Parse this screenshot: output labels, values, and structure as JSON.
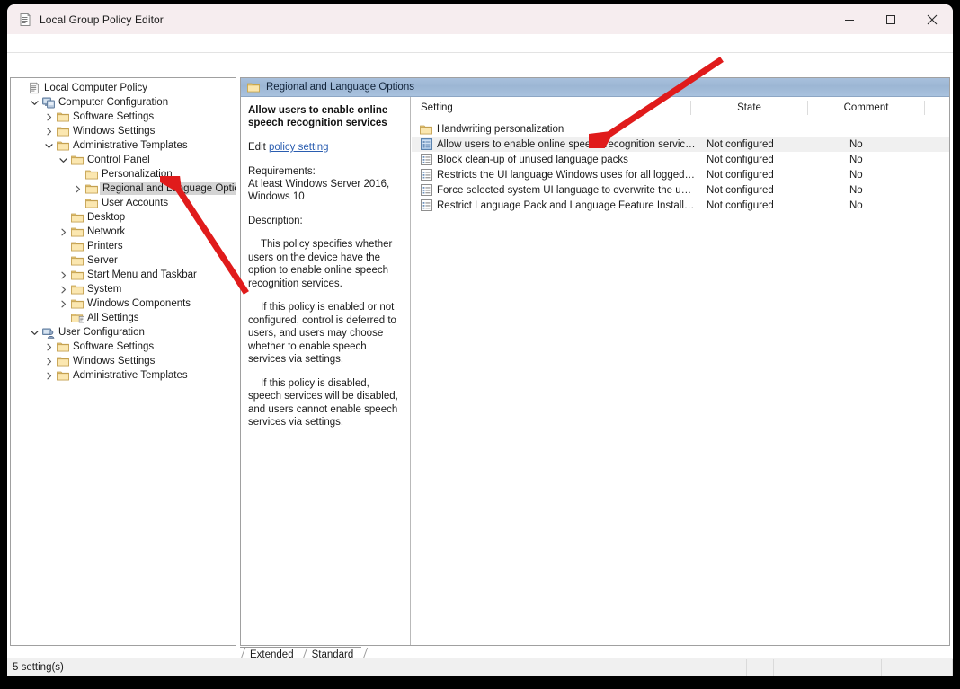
{
  "window": {
    "title": "Local Group Policy Editor",
    "title_icon": "policy-editor-icon",
    "minimize_label": "Minimize",
    "maximize_label": "Maximize",
    "close_label": "Close"
  },
  "tree": {
    "items": [
      {
        "label": "Local Computer Policy",
        "depth": 0,
        "chevron": "none",
        "icon": "policy-icon",
        "selected": false
      },
      {
        "label": "Computer Configuration",
        "depth": 1,
        "chevron": "down",
        "icon": "computer-icon",
        "selected": false
      },
      {
        "label": "Software Settings",
        "depth": 2,
        "chevron": "right",
        "icon": "folder-icon",
        "selected": false
      },
      {
        "label": "Windows Settings",
        "depth": 2,
        "chevron": "right",
        "icon": "folder-icon",
        "selected": false
      },
      {
        "label": "Administrative Templates",
        "depth": 2,
        "chevron": "down",
        "icon": "folder-icon",
        "selected": false
      },
      {
        "label": "Control Panel",
        "depth": 3,
        "chevron": "down",
        "icon": "folder-icon",
        "selected": false
      },
      {
        "label": "Personalization",
        "depth": 4,
        "chevron": "none",
        "icon": "folder-icon",
        "selected": false
      },
      {
        "label": "Regional and Language Options",
        "depth": 4,
        "chevron": "right",
        "icon": "folder-icon",
        "selected": true
      },
      {
        "label": "User Accounts",
        "depth": 4,
        "chevron": "none",
        "icon": "folder-icon",
        "selected": false
      },
      {
        "label": "Desktop",
        "depth": 3,
        "chevron": "none",
        "icon": "folder-icon",
        "selected": false
      },
      {
        "label": "Network",
        "depth": 3,
        "chevron": "right",
        "icon": "folder-icon",
        "selected": false
      },
      {
        "label": "Printers",
        "depth": 3,
        "chevron": "none",
        "icon": "folder-icon",
        "selected": false
      },
      {
        "label": "Server",
        "depth": 3,
        "chevron": "none",
        "icon": "folder-icon",
        "selected": false
      },
      {
        "label": "Start Menu and Taskbar",
        "depth": 3,
        "chevron": "right",
        "icon": "folder-icon",
        "selected": false
      },
      {
        "label": "System",
        "depth": 3,
        "chevron": "right",
        "icon": "folder-icon",
        "selected": false
      },
      {
        "label": "Windows Components",
        "depth": 3,
        "chevron": "right",
        "icon": "folder-icon",
        "selected": false
      },
      {
        "label": "All Settings",
        "depth": 3,
        "chevron": "none",
        "icon": "all-settings-icon",
        "selected": false
      },
      {
        "label": "User Configuration",
        "depth": 1,
        "chevron": "down",
        "icon": "user-icon",
        "selected": false
      },
      {
        "label": "Software Settings",
        "depth": 2,
        "chevron": "right",
        "icon": "folder-icon",
        "selected": false
      },
      {
        "label": "Windows Settings",
        "depth": 2,
        "chevron": "right",
        "icon": "folder-icon",
        "selected": false
      },
      {
        "label": "Administrative Templates",
        "depth": 2,
        "chevron": "right",
        "icon": "folder-icon",
        "selected": false
      }
    ]
  },
  "pane": {
    "header_title": "Regional and Language Options",
    "header_icon": "folder-icon"
  },
  "details": {
    "policy_title": "Allow users to enable online speech recognition services",
    "edit_prefix": "Edit ",
    "edit_link": "policy setting",
    "requirements_label": "Requirements:",
    "requirements_value_line1": "At least Windows Server 2016,",
    "requirements_value_line2": "Windows 10",
    "description_label": "Description:",
    "description_paragraphs": [
      "This policy specifies whether users on the device have the option to enable online speech recognition services.",
      "If this policy is enabled or not configured, control is deferred to users, and users may choose whether to enable speech services via settings.",
      "If this policy is disabled, speech services will be disabled, and users cannot enable speech services via settings."
    ]
  },
  "list": {
    "columns": {
      "setting": "Setting",
      "state": "State",
      "comment": "Comment"
    },
    "rows": [
      {
        "name": "Handwriting personalization",
        "state": "",
        "comment": "",
        "icon": "folder-icon",
        "selected": false
      },
      {
        "name": "Allow users to enable online speech recognition services",
        "state": "Not configured",
        "comment": "No",
        "icon": "policy-setting-selected-icon",
        "selected": true
      },
      {
        "name": "Block clean-up of unused language packs",
        "state": "Not configured",
        "comment": "No",
        "icon": "policy-setting-icon",
        "selected": false
      },
      {
        "name": "Restricts the UI language Windows uses for all logged users",
        "state": "Not configured",
        "comment": "No",
        "icon": "policy-setting-icon",
        "selected": false
      },
      {
        "name": "Force selected system UI language to overwrite the user UI l...",
        "state": "Not configured",
        "comment": "No",
        "icon": "policy-setting-icon",
        "selected": false
      },
      {
        "name": "Restrict Language Pack and Language Feature Installation",
        "state": "Not configured",
        "comment": "No",
        "icon": "policy-setting-icon",
        "selected": false
      }
    ]
  },
  "tabs": [
    {
      "label": "Extended",
      "active": false
    },
    {
      "label": "Standard",
      "active": true
    }
  ],
  "statusbar": {
    "text": "5 setting(s)"
  },
  "annotations": {
    "arrow_color": "#e01b1b",
    "arrow_tree_target": "Regional and Language Options",
    "arrow_list_target": "Allow users to enable online speech recognition services"
  }
}
